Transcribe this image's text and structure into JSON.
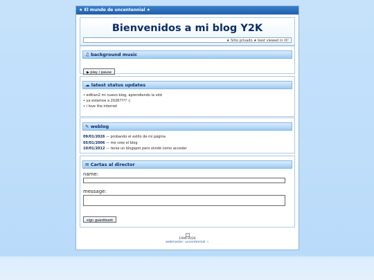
{
  "window": {
    "title": "★ El mundo de uncentennial ★"
  },
  "header": {
    "title": "Bienvenidos a mi blog Y2K",
    "marquee": "★ Sitio privado ★ best viewed in IX!"
  },
  "music": {
    "heading": "♫ background music",
    "button": "▶ play / pause"
  },
  "status": {
    "heading": "☁ latest status updates",
    "items": [
      "• edltian2 mi nuevo blog, aprendiendo la vdd",
      "• ya estamos a 2026???? :(",
      "• i love the internet"
    ]
  },
  "weblog": {
    "heading": "✎ weblog",
    "entries": [
      {
        "date": "09/01/2026",
        "text": " — probando el estilo de mi página"
      },
      {
        "date": "05/01/2006",
        "text": " — me cree el blog"
      },
      {
        "date": "10/01/2012",
        "text": " — tenía un blogspot pero olvidé como acceder"
      }
    ]
  },
  "guestbook": {
    "heading": "✉ Cartas al director",
    "name_label": "name:",
    "message_label": "message:",
    "name_value": "",
    "message_value": "",
    "button": "sign guestbook"
  },
  "footer": {
    "years": "1996-2026",
    "webmaster": "webmaster: uncentennial ☆"
  }
}
